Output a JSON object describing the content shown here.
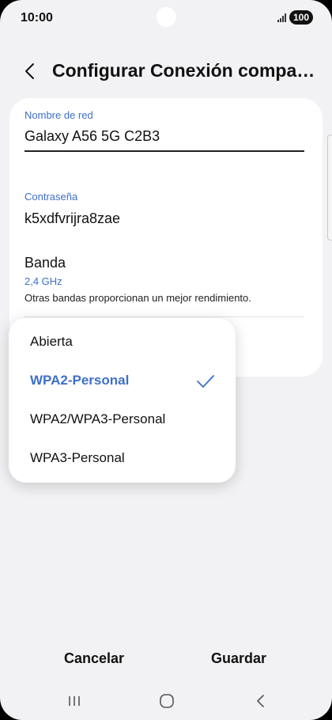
{
  "status_bar": {
    "time": "10:00",
    "battery": "100"
  },
  "header": {
    "title": "Configurar Conexión compartida"
  },
  "form": {
    "network_name": {
      "label": "Nombre de red",
      "value": "Galaxy A56 5G C2B3"
    },
    "password": {
      "label": "Contraseña",
      "value": "k5xdfvrijra8zae"
    },
    "band": {
      "title": "Banda",
      "value": "2,4 GHz",
      "description": "Otras bandas proporcionan un mejor rendimiento."
    }
  },
  "security_dropdown": {
    "options": [
      {
        "label": "Abierta",
        "selected": false
      },
      {
        "label": "WPA2-Personal",
        "selected": true
      },
      {
        "label": "WPA2/WPA3-Personal",
        "selected": false
      },
      {
        "label": "WPA3-Personal",
        "selected": false
      }
    ]
  },
  "actions": {
    "cancel_label": "Cancelar",
    "save_label": "Guardar"
  },
  "icons": {
    "back": "chevron-left-icon",
    "check": "check-icon",
    "nav_recent": "recent-apps-icon",
    "nav_home": "home-icon",
    "nav_back": "back-icon"
  },
  "colors": {
    "accent": "#3e6fc8",
    "background": "#f2f2f4",
    "card": "#ffffff"
  }
}
